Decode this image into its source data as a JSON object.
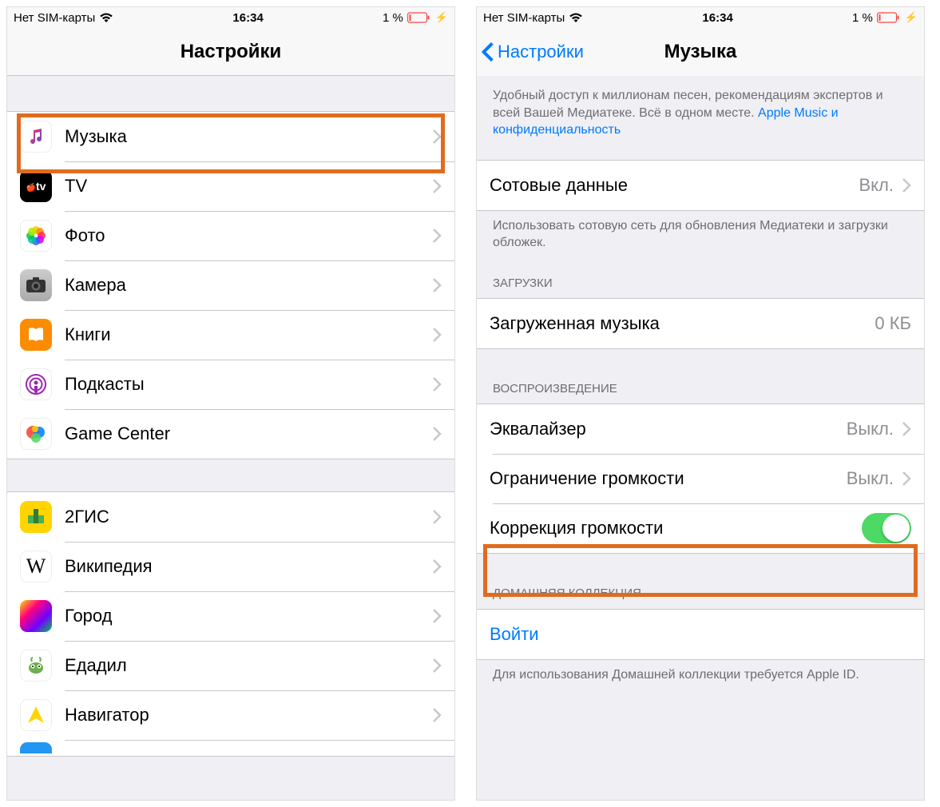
{
  "status": {
    "carrier": "Нет SIM-карты",
    "time": "16:34",
    "battery_pct": "1 %"
  },
  "left": {
    "title": "Настройки",
    "group1": [
      {
        "key": "music",
        "label": "Музыка"
      },
      {
        "key": "tv",
        "label": "TV",
        "iconText": "▶tv"
      },
      {
        "key": "photos",
        "label": "Фото"
      },
      {
        "key": "camera",
        "label": "Камера"
      },
      {
        "key": "books",
        "label": "Книги"
      },
      {
        "key": "podcasts",
        "label": "Подкасты"
      },
      {
        "key": "gamecenter",
        "label": "Game Center"
      }
    ],
    "group2": [
      {
        "key": "2gis",
        "label": "2ГИС"
      },
      {
        "key": "wiki",
        "label": "Википедия",
        "iconText": "W"
      },
      {
        "key": "gorod",
        "label": "Город"
      },
      {
        "key": "edadil",
        "label": "Едадил"
      },
      {
        "key": "navigator",
        "label": "Навигатор"
      }
    ]
  },
  "right": {
    "back": "Настройки",
    "title": "Музыка",
    "topFooter": "Удобный доступ к миллионам песен, рекомендациям экспертов и всей Вашей Медиатеке. Всё в одном месте. ",
    "topFooterLink": "Apple Music и конфиденциальность",
    "cellular": {
      "label": "Сотовые данные",
      "value": "Вкл."
    },
    "cellularFooter": "Использовать сотовую сеть для обновления Медиатеки и загрузки обложек.",
    "downloadsHeader": "ЗАГРУЗКИ",
    "downloaded": {
      "label": "Загруженная музыка",
      "value": "0 КБ"
    },
    "playbackHeader": "ВОСПРОИЗВЕДЕНИЕ",
    "eq": {
      "label": "Эквалайзер",
      "value": "Выкл."
    },
    "volLimit": {
      "label": "Ограничение громкости",
      "value": "Выкл."
    },
    "soundCheck": {
      "label": "Коррекция громкости",
      "on": true
    },
    "homeHeader": "ДОМАШНЯЯ КОЛЛЕКЦИЯ",
    "signIn": "Войти",
    "homeFooter": "Для использования Домашней коллекции требуется Apple ID."
  }
}
